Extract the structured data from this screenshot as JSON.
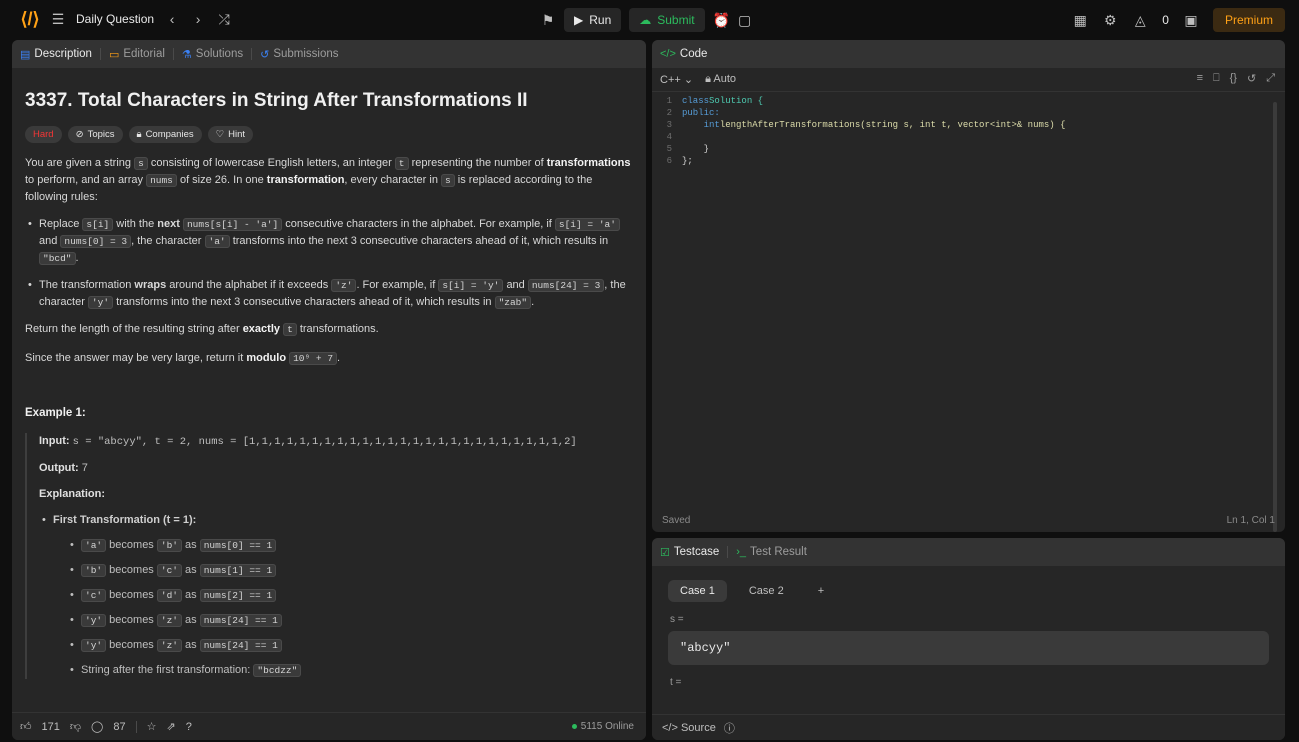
{
  "topbar": {
    "daily_question": "Daily Question",
    "run_label": "Run",
    "submit_label": "Submit",
    "premium_label": "Premium",
    "streak_count": "0"
  },
  "left_tabs": [
    {
      "label": "Description"
    },
    {
      "label": "Editorial"
    },
    {
      "label": "Solutions"
    },
    {
      "label": "Submissions"
    }
  ],
  "problem": {
    "title": "3337. Total Characters in String After Transformations II",
    "difficulty": "Hard",
    "tags": [
      "Topics",
      "Companies",
      "Hint"
    ],
    "intro_1": "You are given a string",
    "intro_s": "s",
    "intro_2": "consisting of lowercase English letters, an integer",
    "intro_t": "t",
    "intro_3": "representing the number of",
    "intro_bold_transformations": "transformations",
    "intro_4": "to perform, and an array",
    "intro_nums": "nums",
    "intro_5": "of size 26. In one",
    "intro_bold_transformation": "transformation",
    "intro_6": ", every character in",
    "intro_s2": "s",
    "intro_7": "is replaced according to the following rules:",
    "bullet1_a": "Replace",
    "bullet1_code1": "s[i]",
    "bullet1_b": "with the",
    "bullet1_bold": "next",
    "bullet1_code2": "nums[s[i] - 'a']",
    "bullet1_c": "consecutive characters in the alphabet. For example, if",
    "bullet1_code3": "s[i] = 'a'",
    "bullet1_d": "and",
    "bullet1_code4": "nums[0] = 3",
    "bullet1_e": ", the character",
    "bullet1_code5": "'a'",
    "bullet1_f": "transforms into the next 3 consecutive characters ahead of it, which results in",
    "bullet1_code6": "\"bcd\"",
    "bullet1_g": ".",
    "bullet2_a": "The transformation",
    "bullet2_bold": "wraps",
    "bullet2_b": "around the alphabet if it exceeds",
    "bullet2_code1": "'z'",
    "bullet2_c": ". For example, if",
    "bullet2_code2": "s[i] = 'y'",
    "bullet2_d": "and",
    "bullet2_code3": "nums[24] = 3",
    "bullet2_e": ", the character",
    "bullet2_code4": "'y'",
    "bullet2_f": "transforms into the next 3 consecutive characters ahead of it, which results in",
    "bullet2_code5": "\"zab\"",
    "bullet2_g": ".",
    "return_a": "Return the length of the resulting string after",
    "return_bold": "exactly",
    "return_code": "t",
    "return_b": "transformations.",
    "modulo_a": "Since the answer may be very large, return it",
    "modulo_bold": "modulo",
    "modulo_code": "10⁹ + 7",
    "modulo_b": ".",
    "example_title": "Example 1:",
    "input_label": "Input:",
    "input_value": "s = \"abcyy\", t = 2, nums = [1,1,1,1,1,1,1,1,1,1,1,1,1,1,1,1,1,1,1,1,1,1,1,1,1,2]",
    "output_label": "Output:",
    "output_value": "7",
    "explanation_label": "Explanation:",
    "first_transformation": "First Transformation (t = 1):",
    "steps": [
      {
        "from": "'a'",
        "to": "'b'",
        "cond": "nums[0] == 1"
      },
      {
        "from": "'b'",
        "to": "'c'",
        "cond": "nums[1] == 1"
      },
      {
        "from": "'c'",
        "to": "'d'",
        "cond": "nums[2] == 1"
      },
      {
        "from": "'y'",
        "to": "'z'",
        "cond": "nums[24] == 1"
      },
      {
        "from": "'y'",
        "to": "'z'",
        "cond": "nums[24] == 1"
      }
    ],
    "becomes_word": "becomes",
    "as_word": "as",
    "after_first": "String after the first transformation:",
    "after_first_code": "\"bcdzz\""
  },
  "left_footer": {
    "likes": "171",
    "comments": "87",
    "online": "5115 Online"
  },
  "code_panel": {
    "tab_label": "Code",
    "language": "C++",
    "auto_label": "Auto",
    "status_left": "Saved",
    "status_right": "Ln 1, Col 1",
    "lines": [
      {
        "n": "1",
        "a": "class",
        "b": " Solution {"
      },
      {
        "n": "2",
        "a": "public:",
        "b": ""
      },
      {
        "n": "3",
        "a": "    int",
        "b": " lengthAfterTransformations(string s, int t, vector<int>& nums) {"
      },
      {
        "n": "4",
        "a": "",
        "b": ""
      },
      {
        "n": "5",
        "a": "",
        "b": "    }"
      },
      {
        "n": "6",
        "a": "",
        "b": "};"
      }
    ]
  },
  "test_panel": {
    "tab_testcase": "Testcase",
    "tab_result": "Test Result",
    "case1": "Case 1",
    "case2": "Case 2",
    "add": "+",
    "s_label": "s =",
    "s_value": "\"abcyy\"",
    "t_label": "t =",
    "footer_source": "Source"
  },
  "colors": {
    "accent": "#ffa116",
    "submit_green": "#2cbb5d",
    "hard_red": "#f63636",
    "bg": "#0f0f0f",
    "panel": "#262626"
  },
  "icons": [
    "logo-icon",
    "list-icon",
    "chevron-left-icon",
    "chevron-right-icon",
    "shuffle-icon",
    "debug-icon",
    "play-icon",
    "upload-cloud-icon",
    "alarm-icon",
    "note-icon",
    "grid-icon",
    "gear-icon",
    "flame-icon",
    "avatar-icon"
  ]
}
